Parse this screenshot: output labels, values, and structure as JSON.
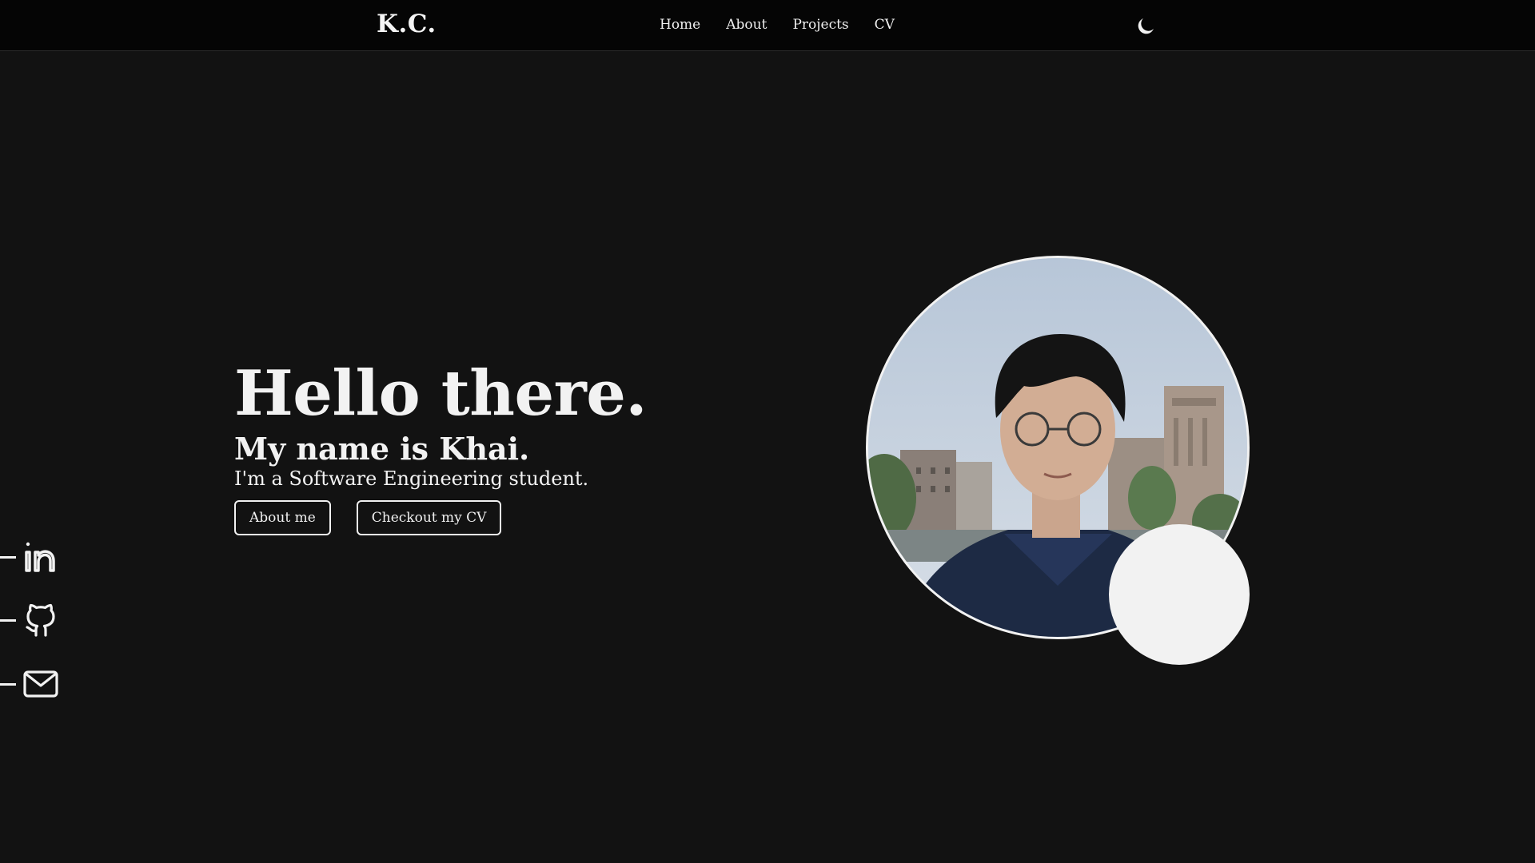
{
  "header": {
    "logo": "K.C.",
    "nav": [
      {
        "label": "Home"
      },
      {
        "label": "About"
      },
      {
        "label": "Projects"
      },
      {
        "label": "CV"
      }
    ],
    "theme_toggle_icon": "moon-icon"
  },
  "hero": {
    "title": "Hello there.",
    "subtitle": "My name is Khai.",
    "description": "I'm a Software Engineering student.",
    "buttons": [
      {
        "label": "About me"
      },
      {
        "label": "Checkout my CV"
      }
    ]
  },
  "socials": [
    {
      "icon": "linkedin-icon"
    },
    {
      "icon": "github-icon"
    },
    {
      "icon": "mail-icon"
    }
  ],
  "colors": {
    "background": "#121212",
    "navbar": "#050505",
    "text": "#f2f2f2"
  }
}
